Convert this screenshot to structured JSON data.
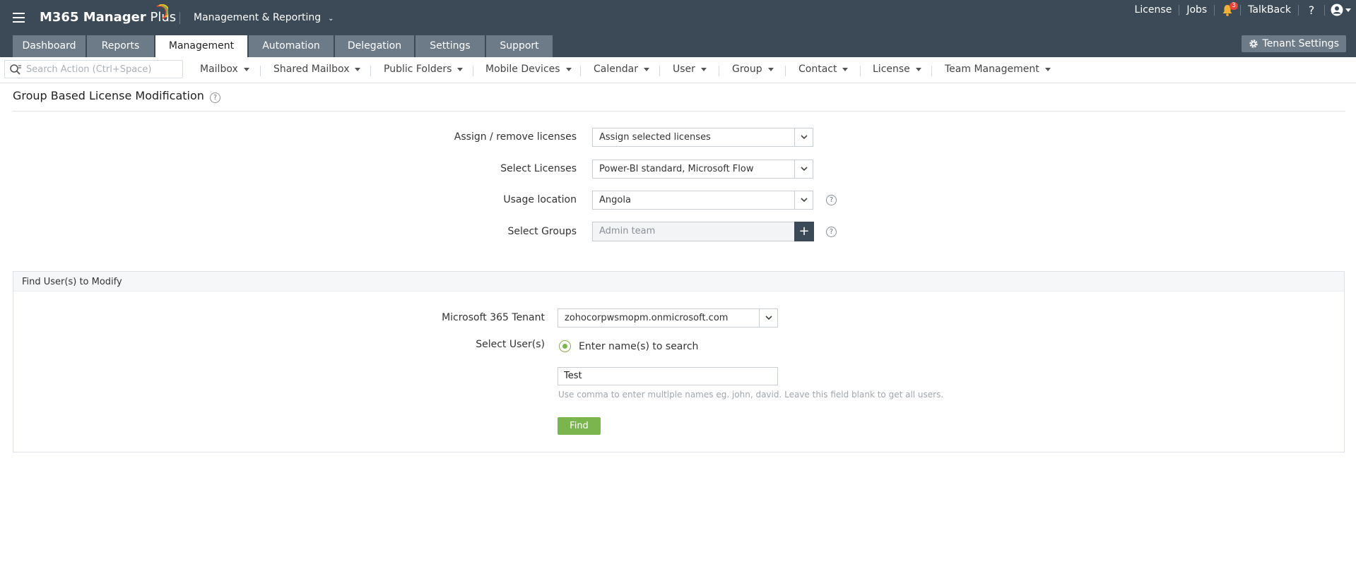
{
  "header": {
    "brand_bold": "M365 Manager",
    "brand_light": " Plus",
    "module": "Management & Reporting",
    "links": {
      "license": "License",
      "jobs": "Jobs",
      "talkback": "TalkBack",
      "help": "?"
    },
    "notification_count": "3",
    "main_tabs": [
      {
        "label": "Dashboard"
      },
      {
        "label": "Reports"
      },
      {
        "label": "Management"
      },
      {
        "label": "Automation"
      },
      {
        "label": "Delegation"
      },
      {
        "label": "Settings"
      },
      {
        "label": "Support"
      }
    ],
    "active_tab": "Management",
    "tenant_settings": "Tenant Settings"
  },
  "subnav": {
    "search_placeholder": "Search Action (Ctrl+Space)",
    "items": [
      {
        "label": "Mailbox"
      },
      {
        "label": "Shared Mailbox"
      },
      {
        "label": "Public Folders"
      },
      {
        "label": "Mobile Devices"
      },
      {
        "label": "Calendar"
      },
      {
        "label": "User"
      },
      {
        "label": "Group"
      },
      {
        "label": "Contact"
      },
      {
        "label": "License"
      },
      {
        "label": "Team Management"
      }
    ]
  },
  "page": {
    "title": "Group Based License Modification",
    "help": "?"
  },
  "form": {
    "assign": {
      "label": "Assign / remove licenses",
      "value": "Assign selected licenses"
    },
    "licenses": {
      "label": "Select Licenses",
      "value": "Power-BI standard, Microsoft Flow"
    },
    "location": {
      "label": "Usage location",
      "value": "Angola"
    },
    "groups": {
      "label": "Select Groups",
      "value": "Admin team",
      "add": "+"
    }
  },
  "find_panel": {
    "heading": "Find User(s) to Modify",
    "tenant": {
      "label": "Microsoft 365 Tenant",
      "value": "zohocorpwsmopm.onmicrosoft.com"
    },
    "users": {
      "label": "Select User(s)",
      "radio_label": "Enter name(s) to search",
      "radio_selected": true,
      "value": "Test",
      "hint": "Use comma to enter multiple names eg. john, david. Leave this field blank to get all users."
    },
    "find_button": "Find"
  },
  "colors": {
    "header_bg": "#3c4a57",
    "tab_bg": "#6d7b88",
    "accent_green": "#7ab54d",
    "badge_red": "#e8443a"
  }
}
